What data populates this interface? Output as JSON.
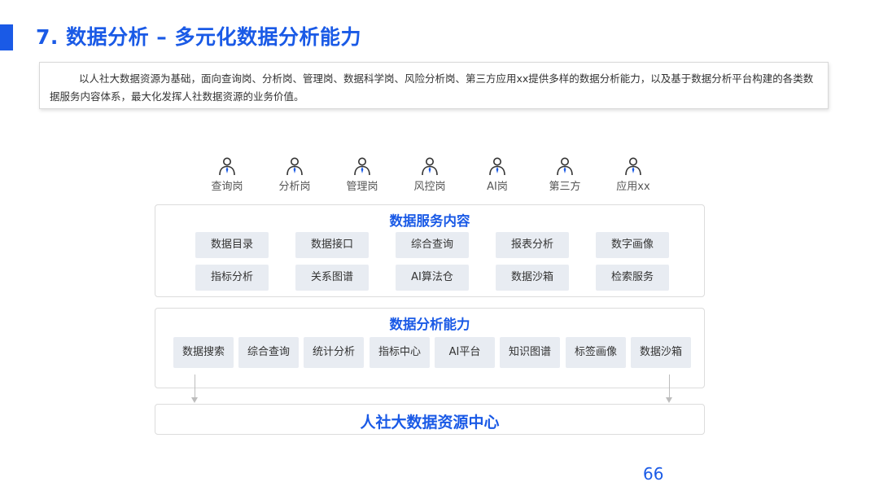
{
  "title": "7. 数据分析 – 多元化数据分析能力",
  "intro": "以人社大数据资源为基础，面向查询岗、分析岗、管理岗、数据科学岗、风险分析岗、第三方应用xx提供多样的数据分析能力，以及基于数据分析平台构建的各类数据服务内容体系，最大化发挥人社数据资源的业务价值。",
  "roles": [
    "查询岗",
    "分析岗",
    "管理岗",
    "风控岗",
    "AI岗",
    "第三方",
    "应用xx"
  ],
  "services": {
    "title": "数据服务内容",
    "items": [
      "数据目录",
      "数据接口",
      "综合查询",
      "报表分析",
      "数字画像",
      "指标分析",
      "关系图谱",
      "AI算法仓",
      "数据沙箱",
      "检索服务"
    ]
  },
  "abilities": {
    "title": "数据分析能力",
    "items": [
      "数据搜索",
      "综合查询",
      "统计分析",
      "指标中心",
      "AI平台",
      "知识图谱",
      "标签画像",
      "数据沙箱"
    ]
  },
  "center": {
    "title": "人社大数据资源中心"
  },
  "page_number": "66",
  "colors": {
    "accent": "#1a5ae6",
    "chip": "#e8ecf2",
    "border": "#dcdcdc"
  }
}
